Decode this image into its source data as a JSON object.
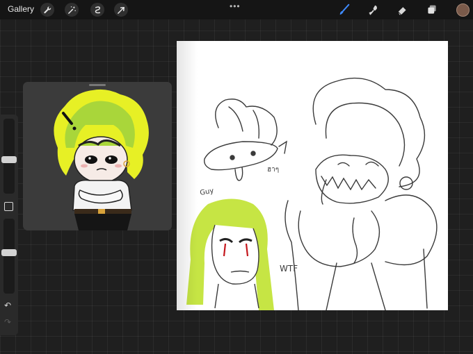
{
  "toolbar": {
    "gallery_label": "Gallery",
    "left_tools": [
      {
        "icon": "wrench-icon",
        "label": "Actions"
      },
      {
        "icon": "magic-wand-icon",
        "label": "Adjustments"
      },
      {
        "icon": "selection-icon",
        "label": "Selection"
      },
      {
        "icon": "arrow-cursor-icon",
        "label": "Transform"
      }
    ],
    "more_label": "•••",
    "right_tools": [
      {
        "icon": "brush-icon",
        "active": true,
        "active_color": "#3f8bff"
      },
      {
        "icon": "smudge-icon"
      },
      {
        "icon": "eraser-icon"
      },
      {
        "icon": "layers-icon"
      }
    ],
    "current_color": "#7a5a4a"
  },
  "sidebar": {
    "brush_size_level": 0.45,
    "opacity_level": 0.55,
    "undo_glyph": "↶",
    "redo_glyph": "↷"
  },
  "reference_window": {
    "highlight_color": "#e7f025",
    "hair_color": "#a9d63a"
  },
  "canvas": {
    "annotations": {
      "label_top": "ฮาๆ",
      "label_guy": "Guy",
      "label_wtf": "WTF"
    },
    "accent_green": "#c3e43a",
    "blood_red": "#c4161c",
    "ink": "#3a3a3a"
  }
}
